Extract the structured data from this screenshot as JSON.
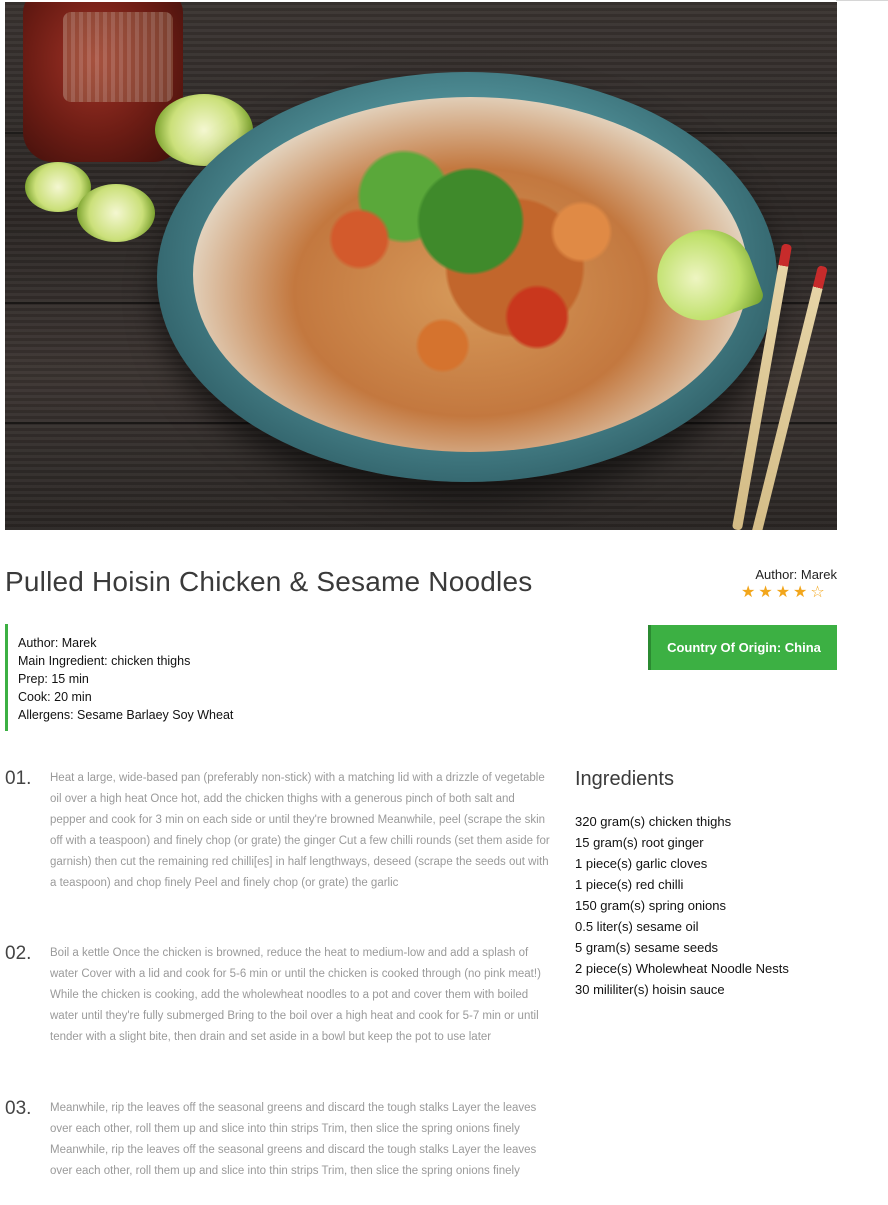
{
  "recipe": {
    "title": "Pulled Hoisin Chicken & Sesame Noodles",
    "author_label": "Author: Marek",
    "rating": 4,
    "rating_max": 5,
    "star_color": "#f2a61c",
    "meta": {
      "author": "Author: Marek",
      "main_ingredient": "Main Ingredient: chicken thighs",
      "prep": "Prep: 15 min",
      "cook": "Cook: 20 min",
      "allergens": "Allergens: Sesame Barlaey Soy Wheat"
    },
    "country_button": "Country Of Origin: China",
    "accent_color": "#3cb043",
    "hero_image": "photo of noodle bowl with chicken, peppers, herbs, lime wedges and chopsticks"
  },
  "steps": [
    {
      "num": "01.",
      "text": "Heat a large, wide-based pan (preferably non-stick) with a matching lid with a drizzle of vegetable oil over a high heat Once hot, add the chicken thighs with a generous pinch of both salt and pepper and cook for 3 min on each side or until they're browned Meanwhile, peel (scrape the skin off with a teaspoon) and finely chop (or grate) the ginger Cut a few chilli rounds (set them aside for garnish) then cut the remaining red chilli[es] in half lengthways, deseed (scrape the seeds out with a teaspoon) and chop finely Peel and finely chop (or grate) the garlic"
    },
    {
      "num": "02.",
      "text": "Boil a kettle Once the chicken is browned, reduce the heat to medium-low and add a splash of water Cover with a lid and cook for 5-6 min or until the chicken is cooked through (no pink meat!) While the chicken is cooking, add the wholewheat noodles to a pot and cover them with boiled water until they're fully submerged Bring to the boil over a high heat and cook for 5-7 min or until tender with a slight bite, then drain and set aside in a bowl but keep the pot to use later"
    },
    {
      "num": "03.",
      "text": "Meanwhile, rip the leaves off the seasonal greens and discard the tough stalks Layer the leaves over each other, roll them up and slice into thin strips Trim, then slice the spring onions finely Meanwhile, rip the leaves off the seasonal greens and discard the tough stalks Layer the leaves over each other, roll them up and slice into thin strips Trim, then slice the spring onions finely"
    }
  ],
  "ingredients": {
    "title": "Ingredients",
    "items": [
      "320 gram(s) chicken thighs",
      "15 gram(s) root ginger",
      "1 piece(s) garlic cloves",
      "1 piece(s) red chilli",
      "150 gram(s) spring onions",
      "0.5 liter(s) sesame oil",
      "5 gram(s) sesame seeds",
      "2 piece(s) Wholewheat Noodle Nests",
      "30 mililiter(s) hoisin sauce"
    ]
  }
}
